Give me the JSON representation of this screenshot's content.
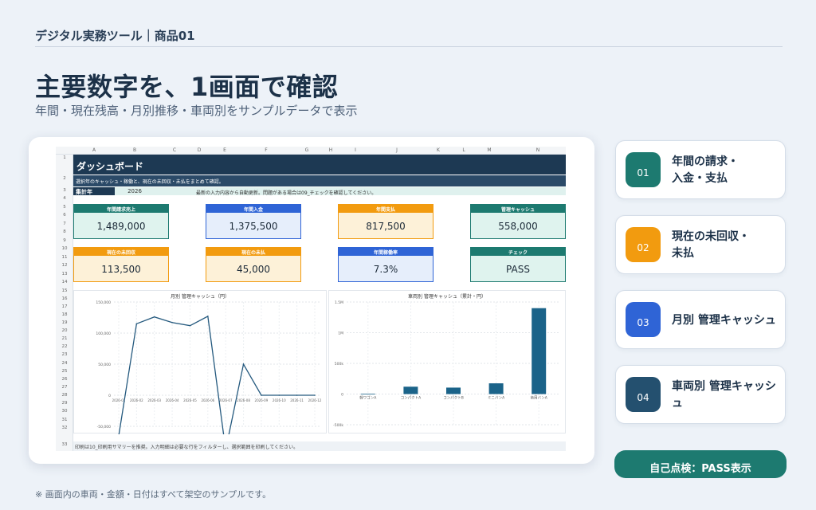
{
  "header": {
    "breadcrumb": "デジタル実務ツール｜商品01"
  },
  "hero": {
    "title": "主要数字を、1画面で確認",
    "subtitle": "年間・現在残高・月別推移・車両別をサンプルデータで表示"
  },
  "sheet": {
    "columns": [
      "A",
      "B",
      "C",
      "D",
      "E",
      "F",
      "G",
      "H",
      "I",
      "J",
      "K",
      "L",
      "M",
      "N"
    ],
    "rows": [
      "1",
      "2",
      "3",
      "4",
      "5",
      "6",
      "7",
      "8",
      "9",
      "10",
      "11",
      "12",
      "13",
      "14",
      "15",
      "16",
      "17",
      "18",
      "19",
      "20",
      "21",
      "22",
      "23",
      "24",
      "25",
      "26",
      "27",
      "28",
      "29",
      "30",
      "31",
      "32",
      "33"
    ],
    "dashboard_title": "ダッシュボード",
    "description": "選択年のキャッシュ・稼働と、現在の未回収・未払をまとめて確認。",
    "year_label": "集計年",
    "year_value": "2026",
    "notice": "最新の入力内容から自動更新。問題がある場合は09_チェックを確認してください。",
    "kpis": [
      {
        "label": "年間請求売上",
        "value": "1,489,000",
        "header_color": "#1d7a70",
        "body_color": "#dff3ee"
      },
      {
        "label": "年間入金",
        "value": "1,375,500",
        "header_color": "#2f64d6",
        "body_color": "#e6eefb"
      },
      {
        "label": "年間支払",
        "value": "817,500",
        "header_color": "#f29b0f",
        "body_color": "#fdf1d8"
      },
      {
        "label": "管理キャッシュ",
        "value": "558,000",
        "header_color": "#1d7a70",
        "body_color": "#dff3ee"
      },
      {
        "label": "現在の未回収",
        "value": "113,500",
        "header_color": "#f29b0f",
        "body_color": "#fdf1d8"
      },
      {
        "label": "現在の未払",
        "value": "45,000",
        "header_color": "#f29b0f",
        "body_color": "#fdf1d8"
      },
      {
        "label": "年間稼働率",
        "value": "7.3%",
        "header_color": "#2f64d6",
        "body_color": "#e6eefb"
      },
      {
        "label": "チェック",
        "value": "PASS",
        "header_color": "#1d7a70",
        "body_color": "#dff3ee"
      }
    ],
    "footnote": "印刷は10_印刷用サマリーを推奨。入力明細は必要な行をフィルターし、選択範囲を印刷してください。"
  },
  "chart_data": [
    {
      "type": "line",
      "title": "月別 管理キャッシュ（円）",
      "x": [
        "2026-01",
        "2026-02",
        "2026-03",
        "2026-04",
        "2026-05",
        "2026-06",
        "2026-07",
        "2026-08",
        "2026-09",
        "2026-10",
        "2026-11",
        "2026-12"
      ],
      "series": [
        {
          "values": [
            -65000,
            115000,
            126000,
            117000,
            112000,
            127000,
            -88000,
            50000,
            0,
            0,
            0,
            0
          ]
        }
      ],
      "y_ticks": [
        "150,000",
        "100,000",
        "50,000",
        "0",
        "-50,000"
      ],
      "ylim": [
        -50000,
        150000
      ],
      "grid": true,
      "color": "#24597e"
    },
    {
      "type": "bar",
      "title": "車両別 管理キャッシュ（累計・円）",
      "categories": [
        "軽ワゴンA",
        "コンパクトA",
        "コンパクトB",
        "ミニバンA",
        "商用バンA"
      ],
      "values": [
        5000,
        120000,
        105000,
        175000,
        1400000
      ],
      "y_ticks": [
        "1.5M",
        "1M",
        "500k",
        "0",
        "-500k"
      ],
      "ylim": [
        -500000,
        1500000
      ],
      "grid": true,
      "color": "#1b6389"
    }
  ],
  "side_cards": [
    {
      "num": "01",
      "label": "年間の請求・\n入金・支払",
      "color": "#1d7a70"
    },
    {
      "num": "02",
      "label": "現在の未回収・\n未払",
      "color": "#f29b0f"
    },
    {
      "num": "03",
      "label": "月別 管理キャッシュ",
      "color": "#2f64d6"
    },
    {
      "num": "04",
      "label": "車両別 管理キャッシュ",
      "color": "#24506f"
    }
  ],
  "pass_button": "自己点検：PASS表示",
  "note": "※ 画面内の車両・金額・日付はすべて架空のサンプルです。"
}
